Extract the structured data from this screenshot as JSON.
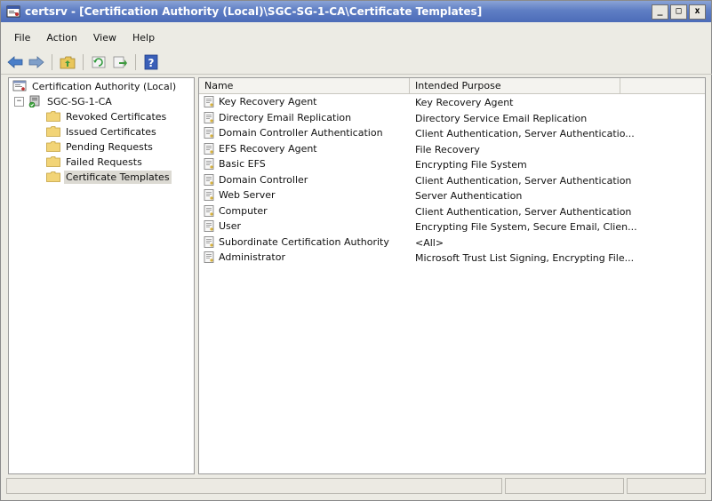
{
  "window": {
    "title": "certsrv - [Certification Authority (Local)\\SGC-SG-1-CA\\Certificate Templates]",
    "controls": [
      "_",
      "□",
      "x"
    ]
  },
  "menu": [
    "File",
    "Action",
    "View",
    "Help"
  ],
  "toolbar": {
    "icons": [
      "back-arrow-icon",
      "forward-arrow-icon",
      "up-folder-icon",
      "refresh-icon",
      "export-icon",
      "help-icon"
    ]
  },
  "tree": {
    "root": "Certification Authority (Local)",
    "ca": "SGC-SG-1-CA",
    "ca_expander": "−",
    "folders": [
      "Revoked Certificates",
      "Issued Certificates",
      "Pending Requests",
      "Failed Requests",
      "Certificate Templates"
    ],
    "selected": "Certificate Templates"
  },
  "list": {
    "columns": [
      "Name",
      "Intended Purpose"
    ],
    "rows": [
      {
        "name": "Key Recovery Agent",
        "purpose": "Key Recovery Agent"
      },
      {
        "name": "Directory Email Replication",
        "purpose": "Directory Service Email Replication"
      },
      {
        "name": "Domain Controller Authentication",
        "purpose": "Client Authentication, Server Authenticatio..."
      },
      {
        "name": "EFS Recovery Agent",
        "purpose": "File Recovery"
      },
      {
        "name": "Basic EFS",
        "purpose": "Encrypting File System"
      },
      {
        "name": "Domain Controller",
        "purpose": "Client Authentication, Server Authentication"
      },
      {
        "name": "Web Server",
        "purpose": "Server Authentication"
      },
      {
        "name": "Computer",
        "purpose": "Client Authentication, Server Authentication"
      },
      {
        "name": "User",
        "purpose": "Encrypting File System, Secure Email, Clien..."
      },
      {
        "name": "Subordinate Certification Authority",
        "purpose": "<All>"
      },
      {
        "name": "Administrator",
        "purpose": "Microsoft Trust List Signing, Encrypting File..."
      }
    ]
  },
  "colors": {
    "titlebar": "#5f7ec4",
    "folder": "#f2d477",
    "selection": "#dcdad3"
  }
}
